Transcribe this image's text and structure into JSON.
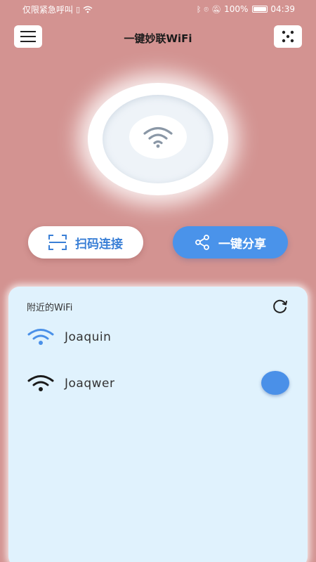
{
  "status_bar": {
    "left_text": "仅限紧急呼叫",
    "battery": "100%",
    "battery_level": 1.0,
    "time": "04:39"
  },
  "header": {
    "title": "一键妙联WiFi",
    "menu_icon": "hamburger-menu-icon",
    "right_icon": "dice-icon"
  },
  "actions": {
    "scan_label": "扫码连接",
    "share_label": "一键分享"
  },
  "nearby": {
    "title": "附近的WiFi",
    "networks": [
      {
        "name": "Joaquin",
        "icon_color": "#4a90e8"
      },
      {
        "name": "Joaqwer",
        "icon_color": "#1a1a1a"
      }
    ]
  },
  "colors": {
    "background": "#d39391",
    "accent": "#4a93ea",
    "panel": "#e0f2fd"
  }
}
